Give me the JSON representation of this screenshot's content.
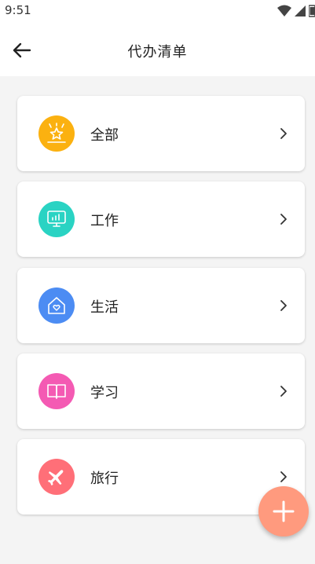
{
  "status_bar": {
    "time": "9:51",
    "icons": [
      "wifi-icon",
      "signal-icon",
      "battery-icon"
    ]
  },
  "app_bar": {
    "title": "代办清单",
    "back_icon": "arrow-left-icon"
  },
  "categories": [
    {
      "label": "全部",
      "icon": "star-badge-icon",
      "color": "#fbb110"
    },
    {
      "label": "工作",
      "icon": "monitor-chart-icon",
      "color": "#2ad3c3"
    },
    {
      "label": "生活",
      "icon": "home-heart-icon",
      "color": "#4c8cf3"
    },
    {
      "label": "学习",
      "icon": "book-icon",
      "color": "#f45ab3"
    },
    {
      "label": "旅行",
      "icon": "airplane-icon",
      "color": "#ff6f78"
    }
  ],
  "fab": {
    "icon": "plus-icon",
    "color": "#ff9a7e"
  }
}
